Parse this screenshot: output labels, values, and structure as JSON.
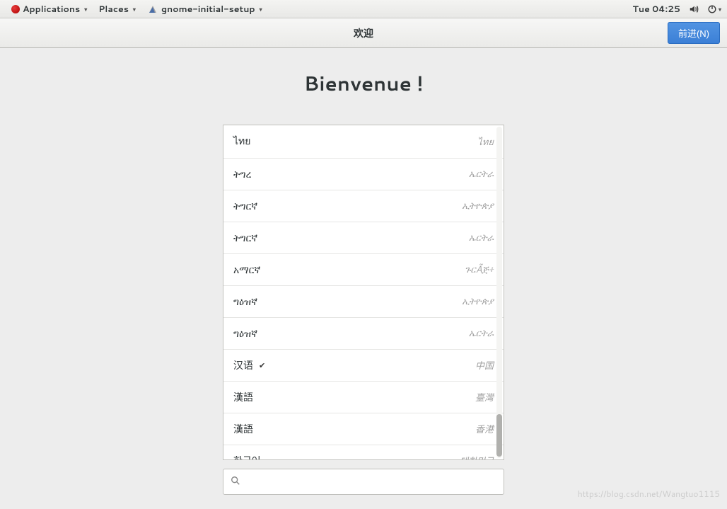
{
  "panel": {
    "applications": "Applications",
    "places": "Places",
    "app_name": "gnome-initial-setup",
    "clock": "Tue 04:25"
  },
  "header": {
    "title": "欢迎",
    "next_label": "前进(N)"
  },
  "welcome": {
    "heading": "Bienvenue !"
  },
  "languages": [
    {
      "name": "ไทย",
      "region": "ไทย",
      "selected": false
    },
    {
      "name": "ትግረ",
      "region": "ኤርትራ",
      "selected": false
    },
    {
      "name": "ትግርኛ",
      "region": "ኢትዮጵያ",
      "selected": false
    },
    {
      "name": "ትግርኛ",
      "region": "ኤርትራ",
      "selected": false
    },
    {
      "name": "አማርኛ",
      "region": "ጉርÃጅ፥",
      "selected": false
    },
    {
      "name": "ግዕዝኛ",
      "region": "ኢትዮጵያ",
      "selected": false
    },
    {
      "name": "ግዕዝኛ",
      "region": "ኤርትራ",
      "selected": false
    },
    {
      "name": "汉语",
      "region": "中国",
      "selected": true
    },
    {
      "name": "漢語",
      "region": "臺灣",
      "selected": false
    },
    {
      "name": "漢語",
      "region": "香港",
      "selected": false
    },
    {
      "name": "한국어",
      "region": "대한민국",
      "selected": false
    }
  ],
  "search": {
    "placeholder": ""
  },
  "watermark": "https://blog.csdn.net/Wangtuo1115"
}
